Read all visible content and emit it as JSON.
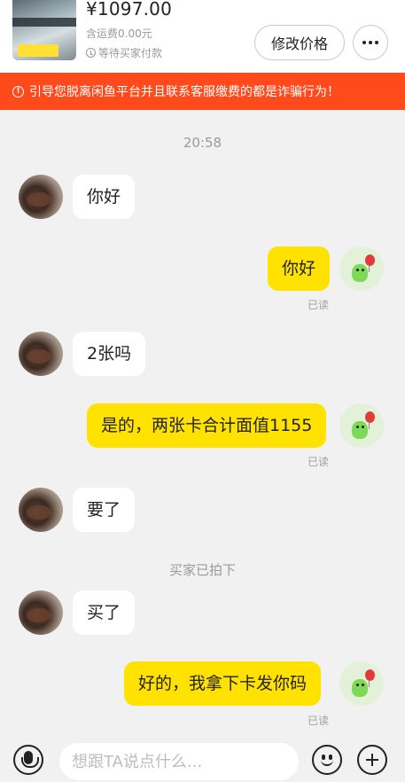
{
  "product": {
    "price": "¥1097.00",
    "shipping": "含运费0.00元",
    "status": "等待买家付款",
    "edit_price_label": "修改价格",
    "more_icon": "more-icon"
  },
  "warning": {
    "icon": "info-icon",
    "text": "引导您脱离闲鱼平台并且联系客服缴费的都是诈骗行为！"
  },
  "chat": {
    "timestamp": "20:58",
    "system_notice": "买家已拍下",
    "read_label": "已读",
    "messages": [
      {
        "from": "buyer",
        "text": "你好"
      },
      {
        "from": "seller",
        "text": "你好"
      },
      {
        "from": "buyer",
        "text": "2张吗"
      },
      {
        "from": "seller",
        "text": "是的，两张卡合计面值1155"
      },
      {
        "from": "buyer",
        "text": "要了"
      },
      {
        "from": "buyer",
        "text": "买了"
      },
      {
        "from": "seller",
        "text": "好的，我拿下卡发你码"
      }
    ]
  },
  "input": {
    "placeholder": "想跟TA说点什么...",
    "voice_icon": "microphone-icon",
    "emoji_icon": "emoji-icon",
    "plus_icon": "plus-icon"
  },
  "colors": {
    "warning_bg": "#ff4a1c",
    "seller_bubble": "#ffe200",
    "buyer_bubble": "#ffffff",
    "background": "#f1f1f1"
  }
}
